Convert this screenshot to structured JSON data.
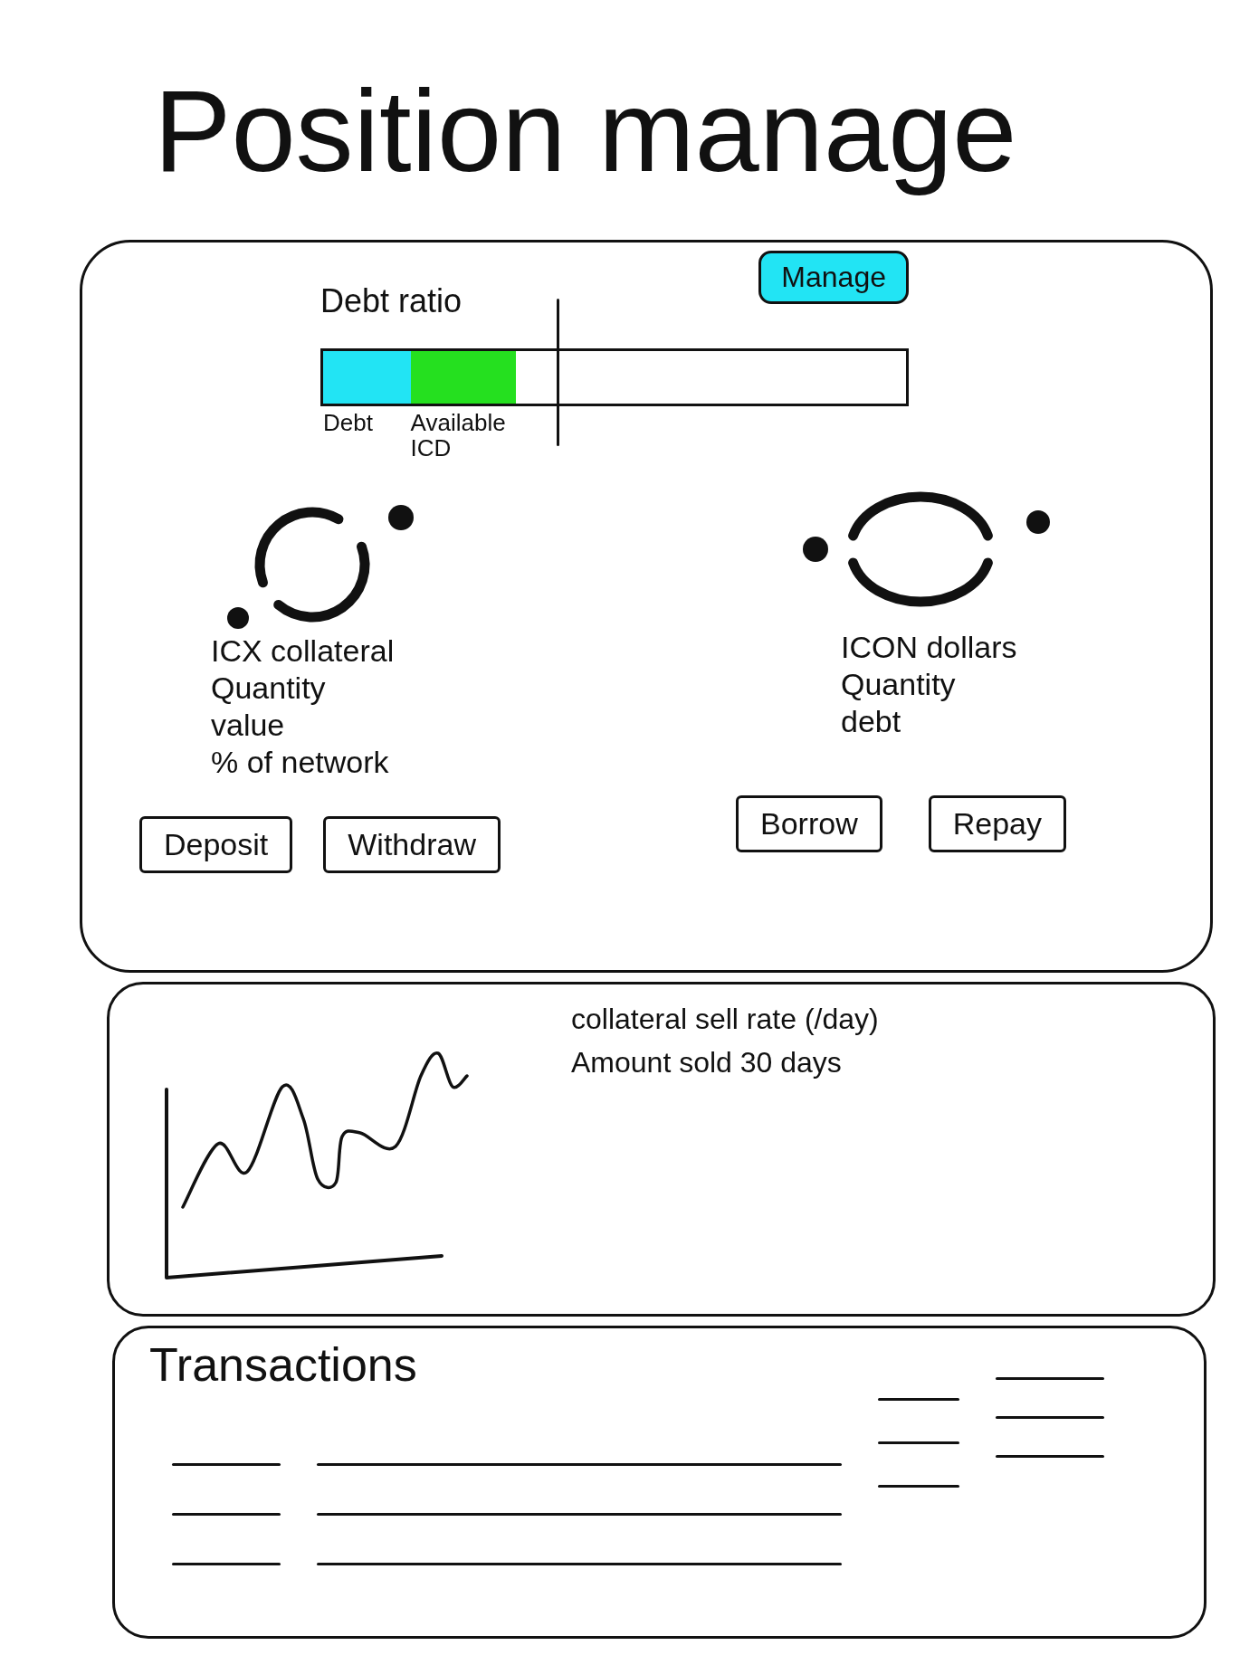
{
  "title": "Position manage",
  "position_card": {
    "debt_ratio": {
      "label": "Debt ratio",
      "manage_button": "Manage",
      "segments": [
        {
          "label": "Debt",
          "level": 0.15,
          "color": "#22e4f4"
        },
        {
          "label": "Available ICD",
          "level": 0.18,
          "color": "#25e01f"
        }
      ],
      "limit": {
        "level": 0.4
      }
    },
    "columns": [
      {
        "kind": "collateral",
        "lines": [
          "ICX collateral",
          "Quantity",
          "value",
          "% of network"
        ],
        "buttons": [
          "Deposit",
          "Withdraw"
        ]
      },
      {
        "kind": "loan",
        "lines": [
          "ICON dollars",
          "Quantity",
          "debt"
        ],
        "buttons": [
          "Borrow",
          "Repay"
        ]
      }
    ]
  },
  "chart_card": {
    "title": "collateral sell rate (/day)",
    "subtitle": "Amount sold 30 days"
  },
  "transactions": {
    "title": "Transactions"
  }
}
